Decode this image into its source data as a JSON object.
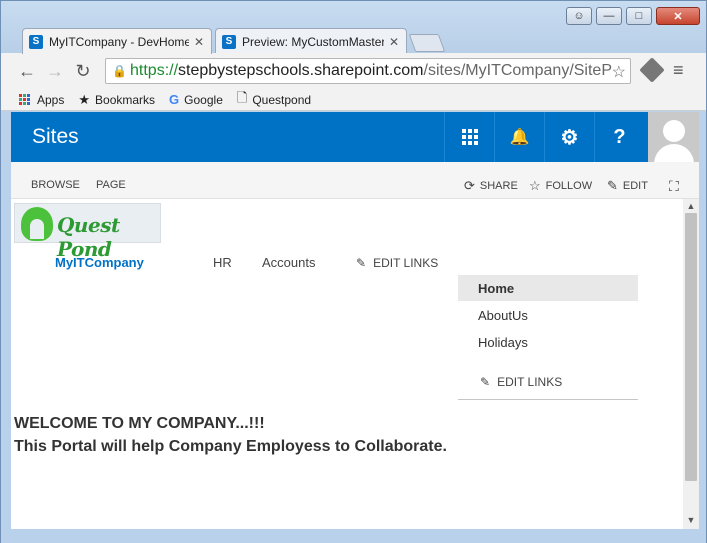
{
  "browser": {
    "tabs": [
      {
        "label": "MyITCompany - DevHome"
      },
      {
        "label": "Preview: MyCustomMaster"
      }
    ],
    "address": {
      "scheme": "https://",
      "host": "stepbystepschools.sharepoint.com",
      "path": "/sites/MyITCompany/SiteP"
    },
    "bookmarks": [
      {
        "label": "Apps",
        "icon": "apps-grid-icon"
      },
      {
        "label": "Bookmarks",
        "icon": "star-icon"
      },
      {
        "label": "Google",
        "icon": "google-icon"
      },
      {
        "label": "Questpond",
        "icon": "page-icon"
      }
    ],
    "window_buttons": {
      "user": "☺",
      "minimize": "—",
      "maximize": "□",
      "close": "✕"
    }
  },
  "suitebar": {
    "title": "Sites",
    "color": "#0072c6",
    "notification_glyph": "🔔",
    "settings_glyph": "⚙",
    "help_label": "?"
  },
  "ribbon": {
    "tabs": [
      "BROWSE",
      "PAGE"
    ],
    "actions": [
      {
        "label": "SHARE",
        "icon": "share-icon"
      },
      {
        "label": "FOLLOW",
        "icon": "star-icon"
      },
      {
        "label": "EDIT",
        "icon": "pencil-icon"
      }
    ]
  },
  "site": {
    "logo_text": "Quest Pond",
    "top_nav": {
      "site_link": "MyITCompany",
      "items": [
        "HR",
        "Accounts"
      ],
      "edit_links": "EDIT LINKS"
    },
    "quick_launch": {
      "items": [
        "Home",
        "AboutUs",
        "Holidays"
      ],
      "selected": "Home",
      "edit_links": "EDIT LINKS"
    },
    "welcome": "WELCOME TO MY COMPANY...!!!",
    "tagline": "This Portal will help Company Employess to Collaborate."
  }
}
